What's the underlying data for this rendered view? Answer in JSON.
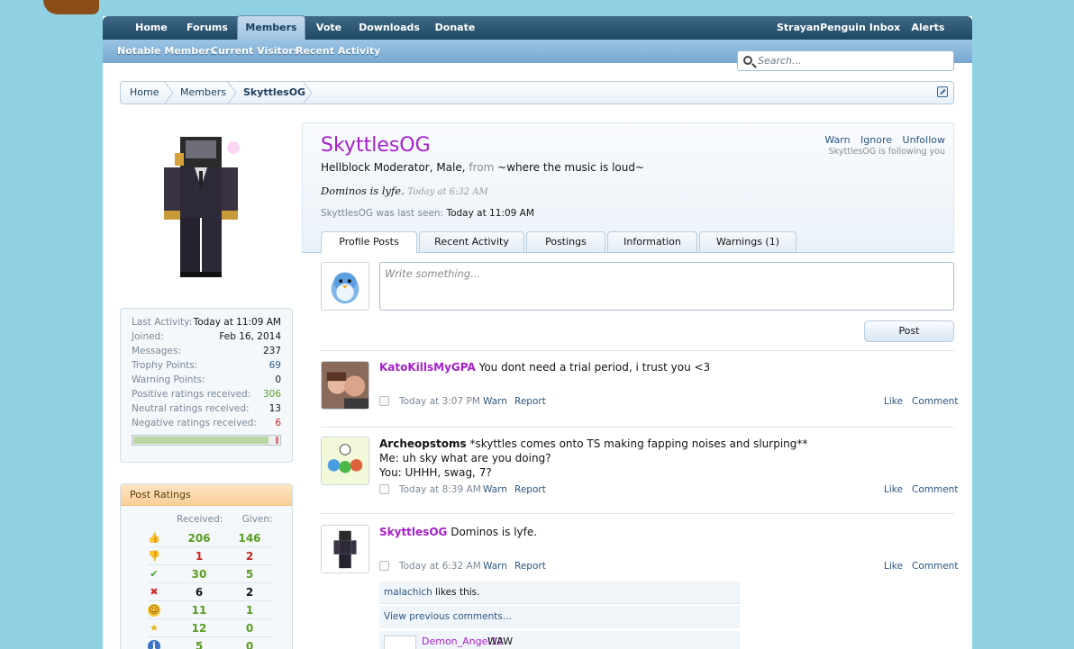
{
  "nav": {
    "tabs": [
      "Home",
      "Forums",
      "Members",
      "Vote",
      "Downloads",
      "Donate"
    ],
    "user": "StrayanPenguin",
    "inbox": "Inbox",
    "alerts": "Alerts"
  },
  "subnav": [
    "Notable Members",
    "Current Visitors",
    "Recent Activity"
  ],
  "search": {
    "placeholder": "Search..."
  },
  "breadcrumb": [
    "Home",
    "Members",
    "SkyttlesOG"
  ],
  "stats": [
    {
      "k": "Last Activity:",
      "v": "Today at 11:09 AM",
      "color": "dark"
    },
    {
      "k": "Joined:",
      "v": "Feb 16, 2014",
      "color": "dark"
    },
    {
      "k": "Messages:",
      "v": "237",
      "color": "dark"
    },
    {
      "k": "Trophy Points:",
      "v": "69",
      "color": "blue"
    },
    {
      "k": "Warning Points:",
      "v": "0",
      "color": "dark"
    },
    {
      "k": "Positive ratings received:",
      "v": "306",
      "color": "green"
    },
    {
      "k": "Neutral ratings received:",
      "v": "13",
      "color": "dark"
    },
    {
      "k": "Negative ratings received:",
      "v": "6",
      "color": "red"
    }
  ],
  "rating_bar": {
    "positive_fraction": 0.95
  },
  "post_ratings": {
    "title": "Post Ratings",
    "received_label": "Received:",
    "given_label": "Given:",
    "rows": [
      {
        "icon": "thumbs-up-icon",
        "glyph": "👍",
        "received": "206",
        "given": "146",
        "color": "green"
      },
      {
        "icon": "thumbs-down-icon",
        "glyph": "👎",
        "received": "1",
        "given": "2",
        "color": "red"
      },
      {
        "icon": "check-icon",
        "glyph": "✔",
        "received": "30",
        "given": "5",
        "color": "green"
      },
      {
        "icon": "cross-icon",
        "glyph": "✖",
        "received": "6",
        "given": "2",
        "color": "dark"
      },
      {
        "icon": "smile-icon",
        "glyph": "☺",
        "received": "11",
        "given": "1",
        "color": "green"
      },
      {
        "icon": "star-badge-icon",
        "glyph": "★",
        "received": "12",
        "given": "0",
        "color": "green"
      },
      {
        "icon": "info-icon",
        "glyph": "i",
        "received": "5",
        "given": "0",
        "color": "green"
      }
    ]
  },
  "profile": {
    "username": "SkyttlesOG",
    "title_text": "Hellblock Moderator, Male,",
    "from_label": "from",
    "location": "~where the music is loud~",
    "status": "Dominos is lyfe.",
    "status_time": "Today at 6:32 AM",
    "last_seen_label": "SkyttlesOG was last seen:",
    "last_seen_value": "Today at 11:09 AM",
    "actions": [
      "Warn",
      "Ignore",
      "Unfollow"
    ],
    "following_note": "SkyttlesOG is following you"
  },
  "tabs": [
    "Profile Posts",
    "Recent Activity",
    "Postings",
    "Information",
    "Warnings (1)"
  ],
  "composer": {
    "placeholder": "Write something...",
    "post_label": "Post"
  },
  "posts": [
    {
      "poster": "KatoKillsMyGPA",
      "lines": [
        "You dont need a trial period, i trust you <3"
      ],
      "time": "Today at 3:07 PM"
    },
    {
      "poster": "Archeopstoms",
      "lines": [
        "*skyttles comes onto TS making fapping noises and slurping**",
        "Me: uh sky what are you doing?",
        "You: UHHH, swag, 7?"
      ],
      "time": "Today at 8:39 AM"
    },
    {
      "poster": "SkyttlesOG",
      "lines": [
        "Dominos is lyfe."
      ],
      "time": "Today at 6:32 AM"
    }
  ],
  "post_actions": {
    "warn": "Warn",
    "report": "Report",
    "like": "Like",
    "comment": "Comment"
  },
  "likes": {
    "user": "malachich",
    "text": "likes this."
  },
  "view_previous": "View previous comments...",
  "comment": {
    "user": "Demon_Angel12",
    "text": "WAW"
  }
}
